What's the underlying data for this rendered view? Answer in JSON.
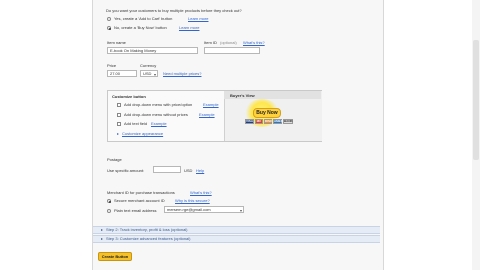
{
  "top": {
    "question": "Do you want your customers to buy multiple products before they check out?",
    "opt_yes": "Yes, create a 'Add to Cart' button",
    "opt_yes_link": "Learn more",
    "opt_no": "No, create a 'Buy Now' button",
    "opt_no_link": "Learn more"
  },
  "item": {
    "name_label": "Item name",
    "name_value": "E-book On Making Money",
    "id_label": "Item ID",
    "id_optional": "(optional)",
    "whats_this": "What's this?",
    "price_label": "Price",
    "price_value": "27.00",
    "currency_label": "Currency",
    "currency_value": "USD",
    "need_multiple": "Need multiple prices?"
  },
  "customize": {
    "title": "Customize button",
    "options": [
      {
        "label": "Add drop-down menu with price/option",
        "link": "Example"
      },
      {
        "label": "Add drop-down menu without prices",
        "link": "Example"
      },
      {
        "label": "Add text field",
        "link": "Example"
      }
    ],
    "customize_link": "Customize appearance"
  },
  "buyers_view": {
    "title": "Buyer's View",
    "button_label": "Buy Now",
    "cards": [
      "VISA",
      "MC",
      "DISC",
      "AMEX",
      "BANK"
    ]
  },
  "postage": {
    "label": "Postage",
    "use_specific": "Use specific amount:",
    "currency": "USD",
    "help": "Help"
  },
  "merchant": {
    "label": "Merchant ID for purchase transactions",
    "whats_this": "What's this?",
    "opt_secure": "Secure merchant account ID",
    "secure_link": "Why is this secure?",
    "opt_email": "Plain text email address",
    "email_value": "mersem.rge@gmail.com"
  },
  "steps": {
    "step2": "Step 2: Track inventory, profit & loss (optional)",
    "step3": "Step 3: Customize advanced features (optional)"
  },
  "create_button": "Create Button",
  "colors": {
    "accordion_bg": "#e6ecf5",
    "button_yellow": "#f5c12b",
    "link_blue": "#3366cc"
  }
}
